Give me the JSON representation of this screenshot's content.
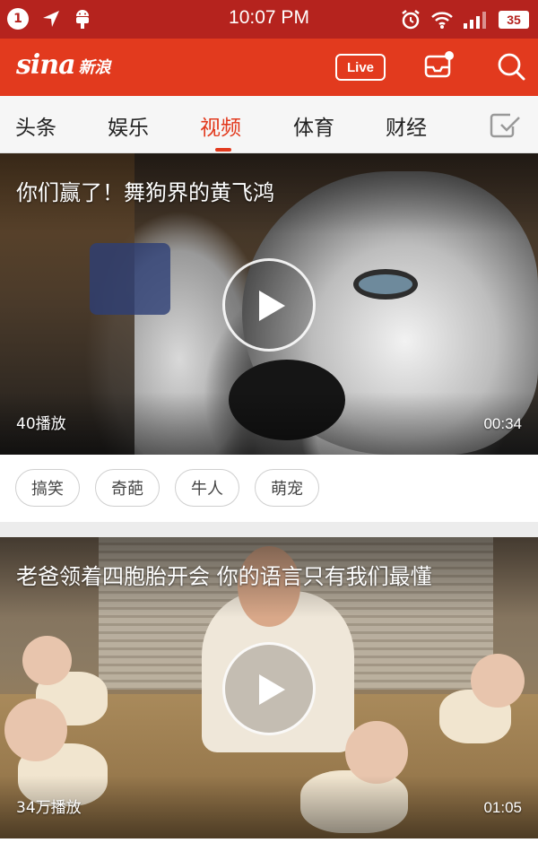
{
  "status_bar": {
    "notification_count": "1",
    "time": "10:07 PM",
    "battery": "35",
    "icons": [
      "location-icon",
      "android-icon",
      "alarm-icon",
      "wifi-icon",
      "signal-icon"
    ]
  },
  "header": {
    "logo_text": "sina",
    "logo_cn": "新浪",
    "live_label": "Live",
    "accent_color": "#e23a1e"
  },
  "tabs": {
    "items": [
      {
        "label": "头条"
      },
      {
        "label": "娱乐"
      },
      {
        "label": "视频"
      },
      {
        "label": "体育"
      },
      {
        "label": "财经"
      }
    ],
    "active": "视频"
  },
  "videos": [
    {
      "title": "你们赢了！舞狗界的黄飞鸿",
      "views": "40播放",
      "duration": "00:34",
      "tags": [
        "搞笑",
        "奇葩",
        "牛人",
        "萌宠"
      ]
    },
    {
      "title": "老爸领着四胞胎开会  你的语言只有我们最懂",
      "views": "34万播放",
      "duration": "01:05"
    }
  ]
}
